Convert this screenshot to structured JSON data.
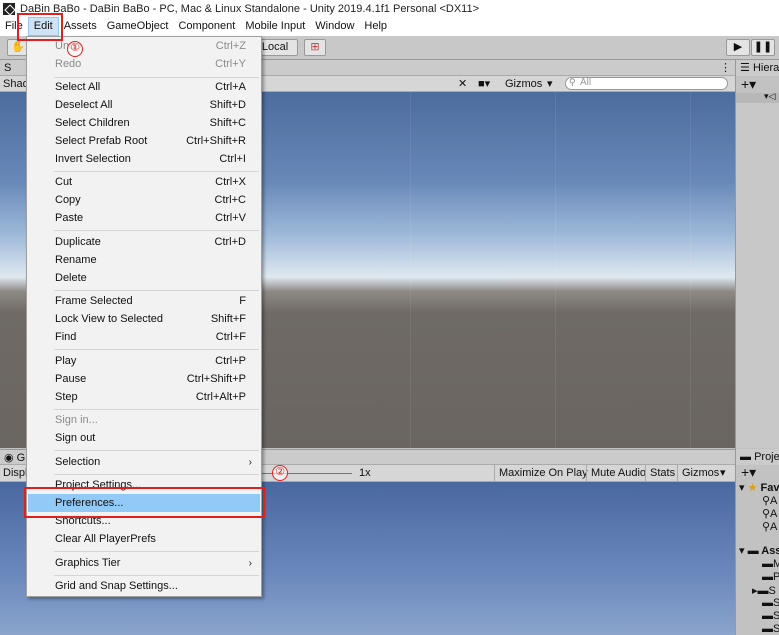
{
  "window": {
    "title": "DaBin BaBo - DaBin BaBo - PC, Mac & Linux Standalone - Unity 2019.4.1f1 Personal <DX11>"
  },
  "menubar": {
    "items": [
      "File",
      "Edit",
      "Assets",
      "GameObject",
      "Component",
      "Mobile Input",
      "Window",
      "Help"
    ]
  },
  "toolbar": {
    "local_label": "Local"
  },
  "scene": {
    "tab_label": "S",
    "shading_label": "Shad",
    "gizmos_label": "Gizmos",
    "search_placeholder": "All"
  },
  "game": {
    "tab_label": "G",
    "display_label": "Displ",
    "scale_value": "1x",
    "maximize_label": "Maximize On Play",
    "mute_label": "Mute Audio",
    "stats_label": "Stats",
    "gizmos_label": "Gizmos"
  },
  "hierarchy": {
    "tab_label": "Hiera"
  },
  "project": {
    "tab_label": "Proje",
    "favorites_label": "Fav",
    "assets_label": "Ass"
  },
  "edit_menu": {
    "items": [
      {
        "label": "Undo",
        "shortcut": "Ctrl+Z",
        "disabled": true
      },
      {
        "label": "Redo",
        "shortcut": "Ctrl+Y",
        "disabled": true
      },
      {
        "label": "Select All",
        "shortcut": "Ctrl+A"
      },
      {
        "label": "Deselect All",
        "shortcut": "Shift+D"
      },
      {
        "label": "Select Children",
        "shortcut": "Shift+C"
      },
      {
        "label": "Select Prefab Root",
        "shortcut": "Ctrl+Shift+R"
      },
      {
        "label": "Invert Selection",
        "shortcut": "Ctrl+I"
      },
      {
        "label": "Cut",
        "shortcut": "Ctrl+X"
      },
      {
        "label": "Copy",
        "shortcut": "Ctrl+C"
      },
      {
        "label": "Paste",
        "shortcut": "Ctrl+V"
      },
      {
        "label": "Duplicate",
        "shortcut": "Ctrl+D"
      },
      {
        "label": "Rename",
        "shortcut": ""
      },
      {
        "label": "Delete",
        "shortcut": ""
      },
      {
        "label": "Frame Selected",
        "shortcut": "F"
      },
      {
        "label": "Lock View to Selected",
        "shortcut": "Shift+F"
      },
      {
        "label": "Find",
        "shortcut": "Ctrl+F"
      },
      {
        "label": "Play",
        "shortcut": "Ctrl+P"
      },
      {
        "label": "Pause",
        "shortcut": "Ctrl+Shift+P"
      },
      {
        "label": "Step",
        "shortcut": "Ctrl+Alt+P"
      },
      {
        "label": "Sign in...",
        "shortcut": "",
        "disabled": true
      },
      {
        "label": "Sign out",
        "shortcut": ""
      },
      {
        "label": "Selection",
        "shortcut": "",
        "submenu": true
      },
      {
        "label": "Project Settings...",
        "shortcut": ""
      },
      {
        "label": "Preferences...",
        "shortcut": "",
        "highlighted": true
      },
      {
        "label": "Shortcuts...",
        "shortcut": ""
      },
      {
        "label": "Clear All PlayerPrefs",
        "shortcut": ""
      },
      {
        "label": "Graphics Tier",
        "shortcut": "",
        "submenu": true
      },
      {
        "label": "Grid and Snap Settings...",
        "shortcut": ""
      }
    ]
  },
  "annotations": {
    "step1": "①",
    "step2": "②",
    "color": "#e02020"
  },
  "colors": {
    "highlight": "#91c9f7",
    "menu_bg": "#f2f2f2"
  }
}
